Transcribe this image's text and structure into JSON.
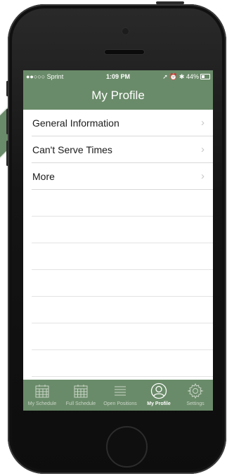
{
  "status_bar": {
    "carrier": "●●○○○ Sprint",
    "time": "1:09 PM",
    "right_icons": "➚ ⏰ ✱ 44%",
    "battery_percent": 44
  },
  "nav": {
    "title": "My Profile"
  },
  "menu": {
    "items": [
      {
        "label": "General Information",
        "chevron": "›"
      },
      {
        "label": "Can't Serve Times",
        "chevron": "›"
      },
      {
        "label": "More",
        "chevron": "›"
      }
    ]
  },
  "tabs": [
    {
      "label": "My Schedule",
      "icon": "calendar-icon",
      "active": false
    },
    {
      "label": "Full Schedule",
      "icon": "calendar-grid-icon",
      "active": false
    },
    {
      "label": "Open Positions",
      "icon": "list-icon",
      "active": false
    },
    {
      "label": "My Profile",
      "icon": "user-icon",
      "active": true
    },
    {
      "label": "Settings",
      "icon": "gear-icon",
      "active": false
    }
  ],
  "colors": {
    "accent": "#6a8b69",
    "tab_inactive": "#c9d6c8"
  }
}
